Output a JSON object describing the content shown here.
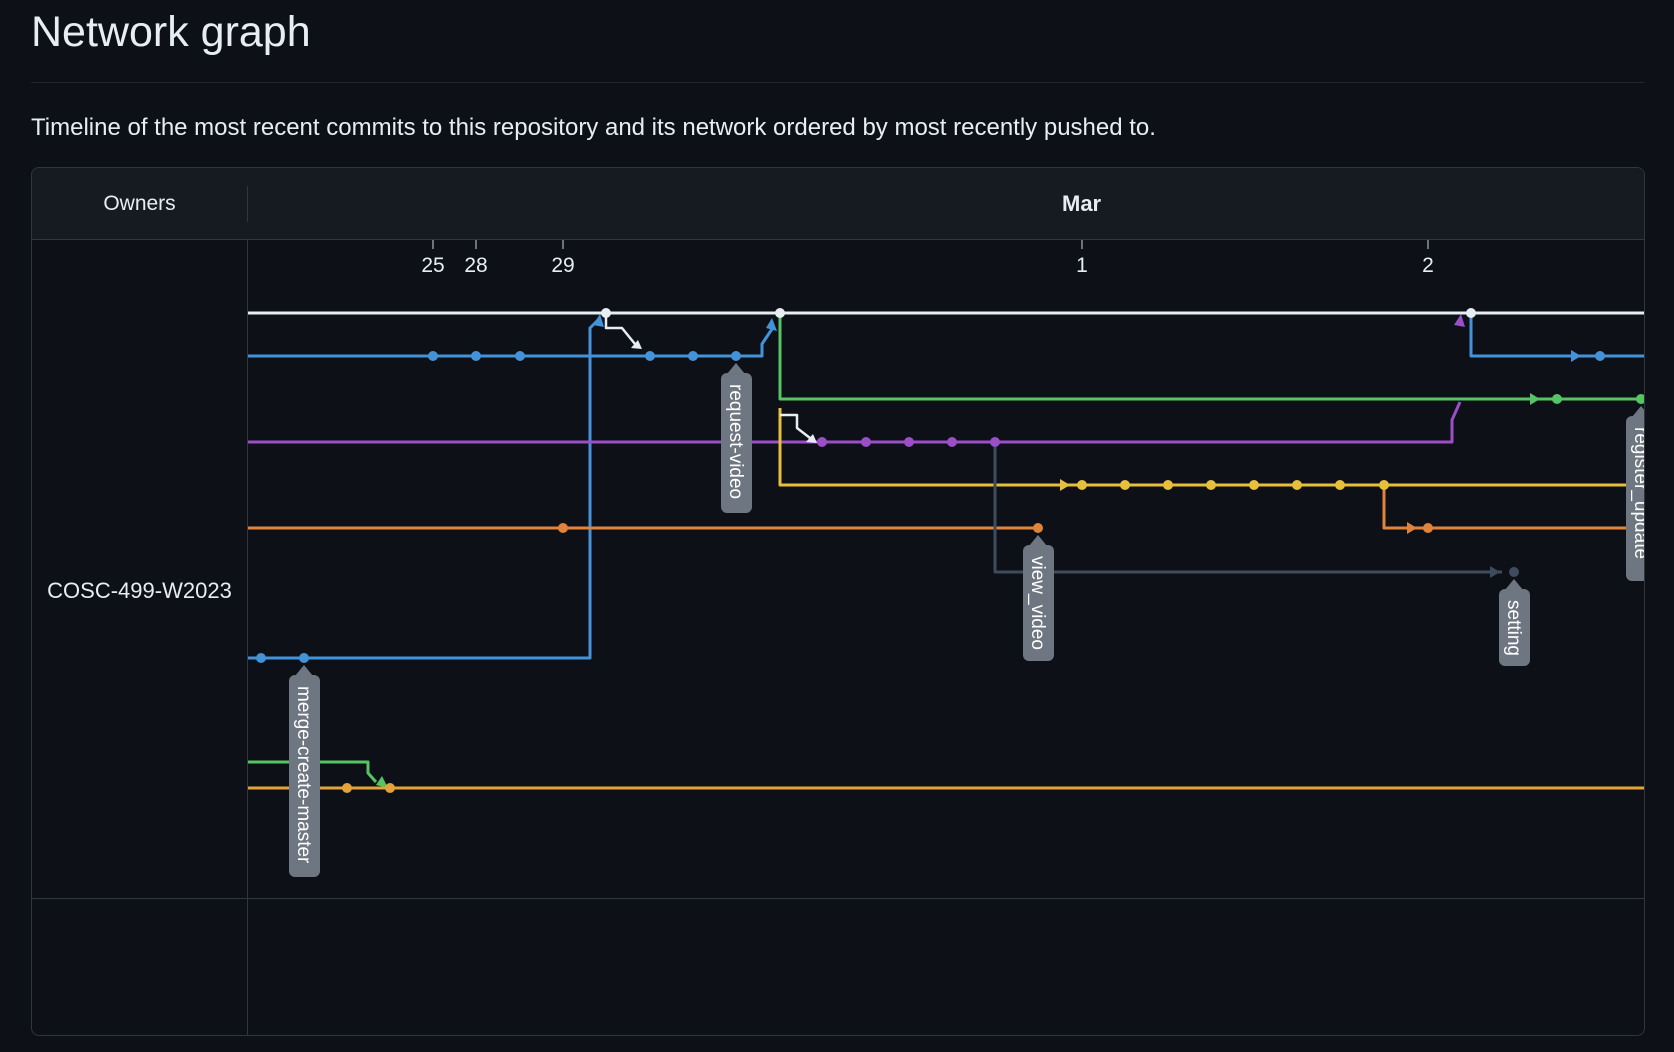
{
  "page": {
    "title": "Network graph",
    "description": "Timeline of the most recent commits to this repository and its network ordered by most recently pushed to."
  },
  "graph": {
    "owners_header": "Owners",
    "month_label": "Mar",
    "owner_name": "COSC-499-W2023",
    "day_ticks": [
      "25",
      "28",
      "29",
      "1",
      "2"
    ],
    "branch_labels": [
      "merge-create-master",
      "request-video",
      "view_video",
      "setting",
      "register_update"
    ],
    "colors": {
      "background": "#0d1117",
      "header": "#161b22",
      "border": "#30363d",
      "main": "#e6edf3",
      "blue": "#4493d9",
      "green": "#56c464",
      "purple": "#9b4fc6",
      "yellow": "#e6c03c",
      "orange": "#e0843c",
      "dark": "#3f4b5e",
      "gold": "#e3a23a",
      "label_bg": "#6e7681"
    }
  }
}
